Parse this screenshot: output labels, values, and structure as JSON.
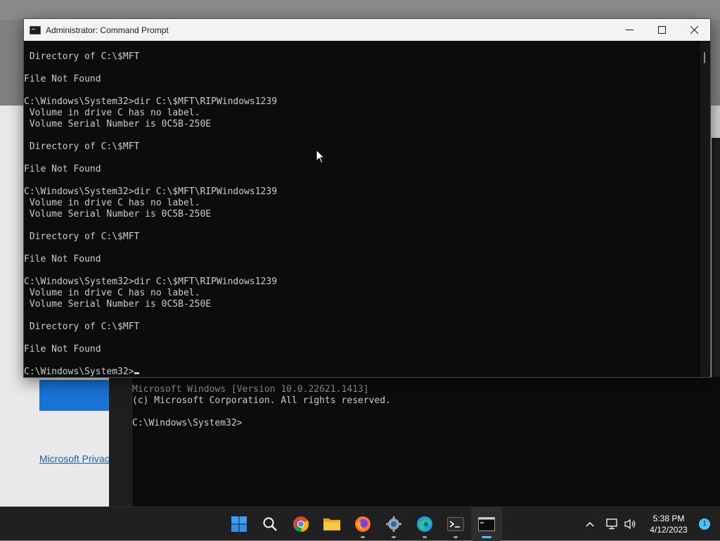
{
  "cmd_window": {
    "title": "Administrator: Command Prompt",
    "lines": [
      " Directory of C:\\$MFT",
      "",
      "File Not Found",
      "",
      "C:\\Windows\\System32>dir C:\\$MFT\\RIPWindows1239",
      " Volume in drive C has no label.",
      " Volume Serial Number is 0C5B-250E",
      "",
      " Directory of C:\\$MFT",
      "",
      "File Not Found",
      "",
      "C:\\Windows\\System32>dir C:\\$MFT\\RIPWindows1239",
      " Volume in drive C has no label.",
      " Volume Serial Number is 0C5B-250E",
      "",
      " Directory of C:\\$MFT",
      "",
      "File Not Found",
      "",
      "C:\\Windows\\System32>dir C:\\$MFT\\RIPWindows1239",
      " Volume in drive C has no label.",
      " Volume Serial Number is 0C5B-250E",
      "",
      " Directory of C:\\$MFT",
      "",
      "File Not Found",
      ""
    ],
    "prompt": "C:\\Windows\\System32>"
  },
  "background_console": {
    "line1": "Microsoft Windows [Version 10.0.22621.1413]",
    "line2": "(c) Microsoft Corporation. All rights reserved.",
    "line3": "",
    "line4": "C:\\Windows\\System32>"
  },
  "background_window": {
    "link_text": "Microsoft Privac"
  },
  "taskbar": {
    "apps": [
      {
        "name": "start-icon",
        "active": false,
        "running": false
      },
      {
        "name": "search-icon",
        "active": false,
        "running": false
      },
      {
        "name": "chrome-icon",
        "active": false,
        "running": false
      },
      {
        "name": "file-explorer-icon",
        "active": false,
        "running": false
      },
      {
        "name": "firefox-icon",
        "active": false,
        "running": true
      },
      {
        "name": "settings-icon",
        "active": false,
        "running": true
      },
      {
        "name": "edge-icon",
        "active": false,
        "running": true
      },
      {
        "name": "terminal-icon",
        "active": false,
        "running": true
      },
      {
        "name": "command-prompt-icon",
        "active": true,
        "running": true
      }
    ],
    "time": "5:38 PM",
    "date": "4/12/2023",
    "notification_count": "1"
  },
  "colors": {
    "console_bg": "#0c0c0c",
    "console_text": "#cccccc",
    "accent": "#4cc2ff",
    "taskbar_bg": "#202020"
  }
}
